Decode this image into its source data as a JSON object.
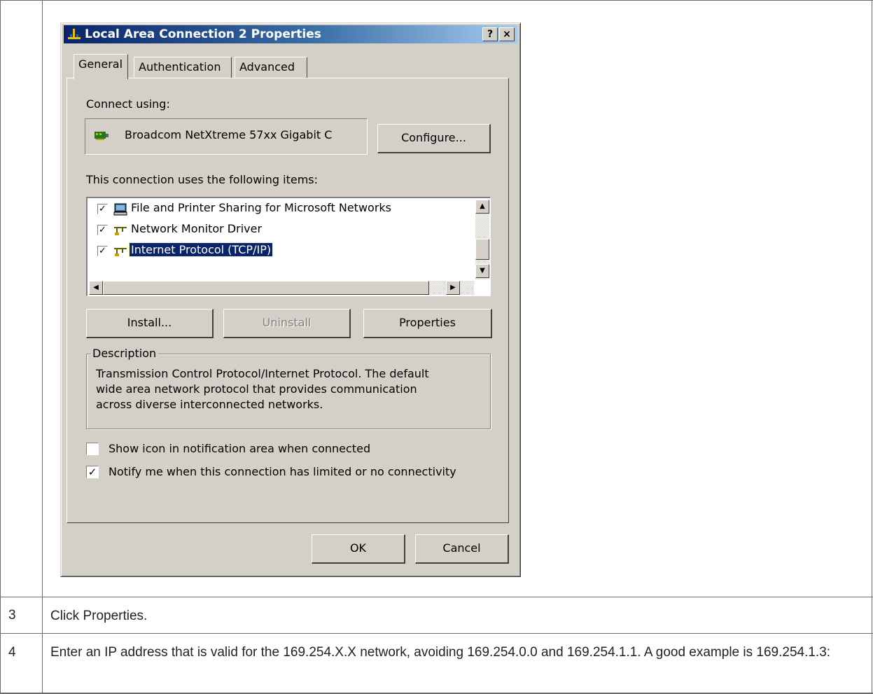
{
  "dialog": {
    "title": "Local Area Connection 2 Properties",
    "help_button": "?",
    "close_button": "×",
    "tabs": [
      {
        "label": "General",
        "active": true
      },
      {
        "label": "Authentication",
        "active": false
      },
      {
        "label": "Advanced",
        "active": false
      }
    ],
    "connect_using_label": "Connect using:",
    "adapter_name": "Broadcom NetXtreme 57xx Gigabit C",
    "configure_button": "Configure...",
    "items_label": "This connection uses the following items:",
    "items": [
      {
        "label": "File and Printer Sharing for Microsoft Networks",
        "checked": true,
        "icon": "computer-icon"
      },
      {
        "label": "Network Monitor Driver",
        "checked": true,
        "icon": "network-protocol-icon"
      },
      {
        "label": "Internet Protocol (TCP/IP)",
        "checked": true,
        "icon": "network-protocol-icon",
        "selected": true
      }
    ],
    "install_button": "Install...",
    "uninstall_button": "Uninstall",
    "properties_button": "Properties",
    "description_legend": "Description",
    "description_lines": [
      "Transmission Control Protocol/Internet Protocol. The default",
      "wide area network protocol that provides communication",
      "across diverse interconnected networks."
    ],
    "show_icon_label": "Show icon in notification area when connected",
    "show_icon_checked": false,
    "notify_label": "Notify me when this connection has limited or no connectivity",
    "notify_checked": true,
    "ok_button": "OK",
    "cancel_button": "Cancel"
  },
  "steps": [
    {
      "number": "3",
      "text": "Click Properties."
    },
    {
      "number": "4",
      "text": "Enter an IP address that is valid for the 169.254.X.X network, avoiding 169.254.0.0 and 169.254.1.1. A good example is 169.254.1.3:"
    }
  ]
}
